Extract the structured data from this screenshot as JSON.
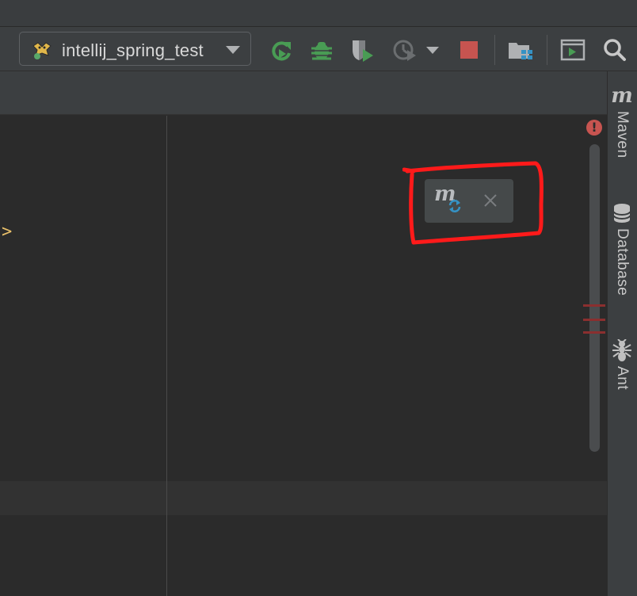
{
  "toolbar": {
    "run_config": {
      "label": "intellij_spring_test",
      "icon": "tomcat-icon"
    },
    "buttons": [
      {
        "name": "rerun-button",
        "icon": "rerun-icon"
      },
      {
        "name": "debug-button",
        "icon": "bug-icon"
      },
      {
        "name": "run-with-coverage-button",
        "icon": "coverage-icon"
      },
      {
        "name": "profile-button",
        "icon": "profiler-icon"
      },
      {
        "name": "stop-button",
        "icon": "stop-icon"
      },
      {
        "name": "project-structure-button",
        "icon": "project-structure-icon"
      },
      {
        "name": "run-anything-button",
        "icon": "run-anything-icon"
      },
      {
        "name": "search-everywhere-button",
        "icon": "search-icon"
      }
    ]
  },
  "editor": {
    "code_fragment": ">",
    "error_indicator": "!"
  },
  "maven_popup": {
    "icon": "maven-reload-icon",
    "glyph": "m",
    "close_icon": "close-icon"
  },
  "right_bar": {
    "items": [
      {
        "label": "Maven",
        "icon": "maven-icon",
        "glyph": "m"
      },
      {
        "label": "Database",
        "icon": "database-icon"
      },
      {
        "label": "Ant",
        "icon": "ant-icon"
      }
    ]
  },
  "colors": {
    "toolbar_bg": "#3c3f41",
    "editor_bg": "#2b2b2b",
    "run_green": "#499c54",
    "stop_red": "#c75450",
    "annotation_red": "#ff1a1a",
    "sync_blue": "#3592c4"
  }
}
